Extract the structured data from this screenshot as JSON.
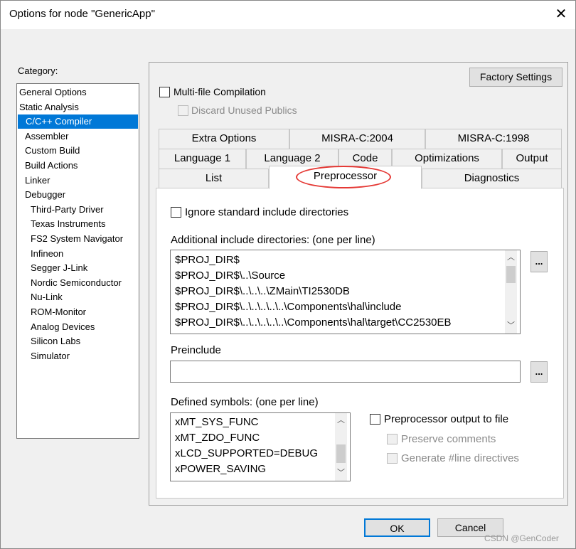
{
  "window": {
    "title": "Options for node \"GenericApp\"",
    "close_glyph": "✕"
  },
  "category": {
    "label": "Category:",
    "items": [
      {
        "label": "General Options"
      },
      {
        "label": "Static Analysis"
      },
      {
        "label": "C/C++ Compiler",
        "selected": true
      },
      {
        "label": "Assembler"
      },
      {
        "label": "Custom Build"
      },
      {
        "label": "Build Actions"
      },
      {
        "label": "Linker"
      },
      {
        "label": "Debugger"
      },
      {
        "label": "Third-Party Driver"
      },
      {
        "label": "Texas Instruments"
      },
      {
        "label": "FS2 System Navigator"
      },
      {
        "label": "Infineon"
      },
      {
        "label": "Segger J-Link"
      },
      {
        "label": "Nordic Semiconductor"
      },
      {
        "label": "Nu-Link"
      },
      {
        "label": "ROM-Monitor"
      },
      {
        "label": "Analog Devices"
      },
      {
        "label": "Silicon Labs"
      },
      {
        "label": "Simulator"
      }
    ]
  },
  "panel": {
    "factory_settings": "Factory Settings",
    "multi_file": "Multi-file Compilation",
    "discard_unused": "Discard Unused Publics",
    "tabs_row1": [
      "Extra Options",
      "MISRA-C:2004",
      "MISRA-C:1998"
    ],
    "tabs_row2": [
      "Language 1",
      "Language 2",
      "Code",
      "Optimizations",
      "Output"
    ],
    "tabs_row3": [
      "List",
      "Preprocessor",
      "Diagnostics"
    ],
    "active_tab": "Preprocessor"
  },
  "preprocessor": {
    "ignore_std": "Ignore standard include directories",
    "additional_label": "Additional include directories: (one per line)",
    "include_dirs": [
      "$PROJ_DIR$",
      "$PROJ_DIR$\\..\\Source",
      "$PROJ_DIR$\\..\\..\\..\\ZMain\\TI2530DB",
      "$PROJ_DIR$\\..\\..\\..\\..\\..\\Components\\hal\\include",
      "$PROJ_DIR$\\..\\..\\..\\..\\..\\Components\\hal\\target\\CC2530EB"
    ],
    "ellipsis": "...",
    "preinclude_label": "Preinclude",
    "preinclude_value": "",
    "defined_label": "Defined symbols: (one per line)",
    "defined_symbols": [
      "xMT_SYS_FUNC",
      "xMT_ZDO_FUNC",
      "xLCD_SUPPORTED=DEBUG",
      "xPOWER_SAVING"
    ],
    "pp_output": "Preprocessor output to file",
    "preserve_comments": "Preserve comments",
    "generate_line": "Generate #line directives"
  },
  "footer": {
    "ok": "OK",
    "cancel": "Cancel",
    "watermark": "CSDN @GenCoder"
  },
  "colors": {
    "selection": "#0078d7",
    "highlight_oval": "#e53935"
  }
}
